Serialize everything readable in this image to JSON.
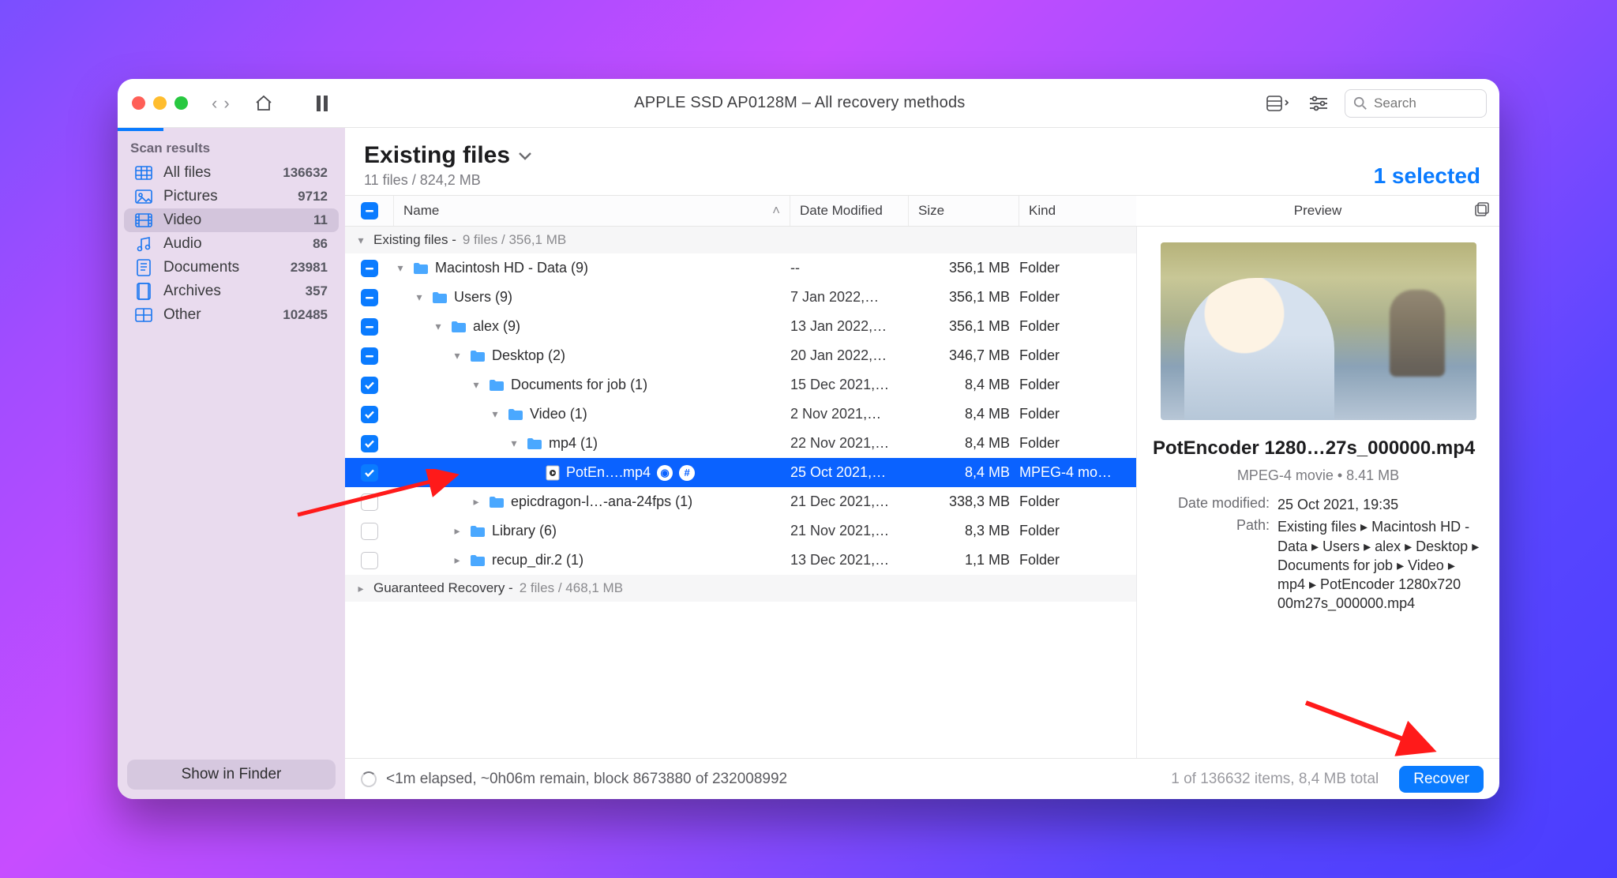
{
  "window": {
    "title": "APPLE SSD AP0128M – All recovery methods",
    "search_placeholder": "Search"
  },
  "sidebar": {
    "header": "Scan results",
    "items": [
      {
        "icon": "grid",
        "label": "All files",
        "count": "136632"
      },
      {
        "icon": "image",
        "label": "Pictures",
        "count": "9712"
      },
      {
        "icon": "film",
        "label": "Video",
        "count": "11",
        "active": true
      },
      {
        "icon": "music",
        "label": "Audio",
        "count": "86"
      },
      {
        "icon": "doc",
        "label": "Documents",
        "count": "23981"
      },
      {
        "icon": "archive",
        "label": "Archives",
        "count": "357"
      },
      {
        "icon": "grid",
        "label": "Other",
        "count": "102485"
      }
    ],
    "show_in_finder": "Show in Finder"
  },
  "heading": {
    "title": "Existing files",
    "subtitle": "11 files / 824,2 MB",
    "selected": "1 selected"
  },
  "columns": {
    "name": "Name",
    "date": "Date Modified",
    "size": "Size",
    "kind": "Kind"
  },
  "groups": [
    {
      "label": "Existing files -",
      "meta": "9 files / 356,1 MB"
    },
    {
      "label": "Guaranteed Recovery -",
      "meta": "2 files / 468,1 MB"
    }
  ],
  "rows": [
    {
      "cb": "minus",
      "indent": 0,
      "chev": "down",
      "icon": "folder",
      "name": "Macintosh HD - Data (9)",
      "date": "--",
      "size": "356,1 MB",
      "kind": "Folder"
    },
    {
      "cb": "minus",
      "indent": 1,
      "chev": "down",
      "icon": "folder",
      "name": "Users (9)",
      "date": "7 Jan 2022,…",
      "size": "356,1 MB",
      "kind": "Folder"
    },
    {
      "cb": "minus",
      "indent": 2,
      "chev": "down",
      "icon": "folder",
      "name": "alex (9)",
      "date": "13 Jan 2022,…",
      "size": "356,1 MB",
      "kind": "Folder"
    },
    {
      "cb": "minus",
      "indent": 3,
      "chev": "down",
      "icon": "folder",
      "name": "Desktop (2)",
      "date": "20 Jan 2022,…",
      "size": "346,7 MB",
      "kind": "Folder"
    },
    {
      "cb": "check",
      "indent": 4,
      "chev": "down",
      "icon": "folder",
      "name": "Documents for job (1)",
      "date": "15 Dec 2021,…",
      "size": "8,4 MB",
      "kind": "Folder"
    },
    {
      "cb": "check",
      "indent": 5,
      "chev": "down",
      "icon": "folder",
      "name": "Video (1)",
      "date": "2 Nov 2021,…",
      "size": "8,4 MB",
      "kind": "Folder"
    },
    {
      "cb": "check",
      "indent": 6,
      "chev": "down",
      "icon": "folder",
      "name": "mp4 (1)",
      "date": "22 Nov 2021,…",
      "size": "8,4 MB",
      "kind": "Folder"
    },
    {
      "cb": "check",
      "indent": 7,
      "chev": "",
      "icon": "movie",
      "name": "PotEn….mp4",
      "date": "25 Oct 2021,…",
      "size": "8,4 MB",
      "kind": "MPEG-4 mo…",
      "selected": true,
      "badges": true
    },
    {
      "cb": "empty",
      "indent": 4,
      "chev": "right",
      "icon": "folder",
      "name": "epicdragon-l…-ana-24fps (1)",
      "date": "21 Dec 2021,…",
      "size": "338,3 MB",
      "kind": "Folder"
    },
    {
      "cb": "empty",
      "indent": 3,
      "chev": "right",
      "icon": "folder",
      "name": "Library (6)",
      "date": "21 Nov 2021,…",
      "size": "8,3 MB",
      "kind": "Folder"
    },
    {
      "cb": "empty",
      "indent": 3,
      "chev": "right",
      "icon": "folder",
      "name": "recup_dir.2 (1)",
      "date": "13 Dec 2021,…",
      "size": "1,1 MB",
      "kind": "Folder"
    }
  ],
  "status": {
    "left": "<1m elapsed, ~0h06m remain, block 8673880 of 232008992",
    "right": "1 of 136632 items, 8,4 MB total",
    "recover": "Recover"
  },
  "preview": {
    "header": "Preview",
    "title": "PotEncoder 1280…27s_000000.mp4",
    "meta": "MPEG-4 movie • 8.41 MB",
    "date_label": "Date modified:",
    "date_value": "25 Oct 2021, 19:35",
    "path_label": "Path:",
    "path_value": "Existing files ▸ Macintosh HD - Data ▸ Users ▸ alex ▸ Desktop ▸ Documents for job ▸ Video ▸ mp4 ▸ PotEncoder 1280x720 00m27s_000000.mp4"
  }
}
